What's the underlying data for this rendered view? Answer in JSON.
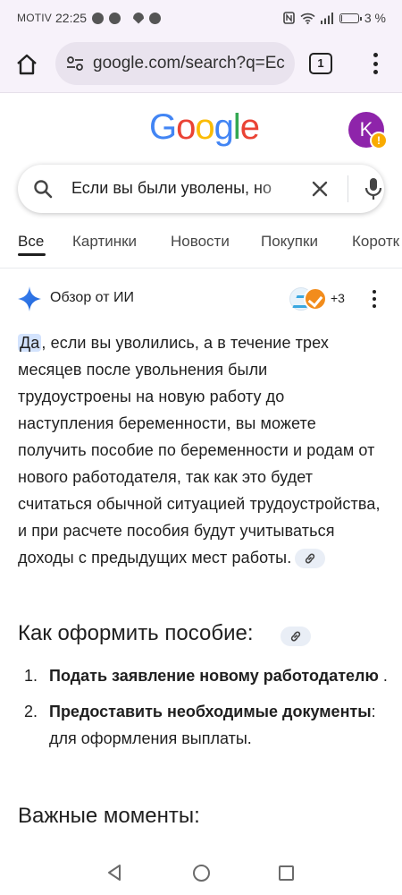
{
  "status_bar": {
    "carrier": "MOTIV",
    "time": "22:25",
    "battery_text": "3 %"
  },
  "browser": {
    "url": "google.com/search?q=Ес",
    "tab_count": "1"
  },
  "google": {
    "logo": [
      "G",
      "o",
      "o",
      "g",
      "l",
      "e"
    ],
    "logo_colors": [
      "#4285F4",
      "#EA4335",
      "#FBBC05",
      "#4285F4",
      "#34A853",
      "#EA4335"
    ],
    "avatar_letter": "K",
    "avatar_badge": "!",
    "avatar_color": "#8e24aa"
  },
  "search": {
    "query": "Если вы были уволены, но"
  },
  "tabs": [
    "Все",
    "Картинки",
    "Новости",
    "Покупки",
    "Коротк"
  ],
  "ai_overview": {
    "title": "Обзор от ИИ",
    "more_sources": "+3",
    "answer_highlight": "Да",
    "answer_rest": ", если вы уволились, а в течение трех месяцев после увольнения были трудоустроены на новую работу до наступления беременности, вы можете получить пособие по беременности и родам от нового работодателя, так как это будет считаться обычной ситуацией трудоустройства, и при расчете пособия будут учитываться доходы с предыдущих мест работы.",
    "heading_how": "Как оформить пособие:",
    "steps": [
      {
        "num": "1.",
        "bold": "Подать заявление новому работодателю",
        "rest": " ."
      },
      {
        "num": "2.",
        "bold": "Предоставить необходимые документы",
        "rest": ": для оформления выплаты."
      }
    ],
    "heading_important": "Важные моменты:"
  },
  "colors": {
    "browser_bg": "#f7f2fa",
    "highlight": "#d3e3fd",
    "accent_blue": "#1a73e8"
  }
}
